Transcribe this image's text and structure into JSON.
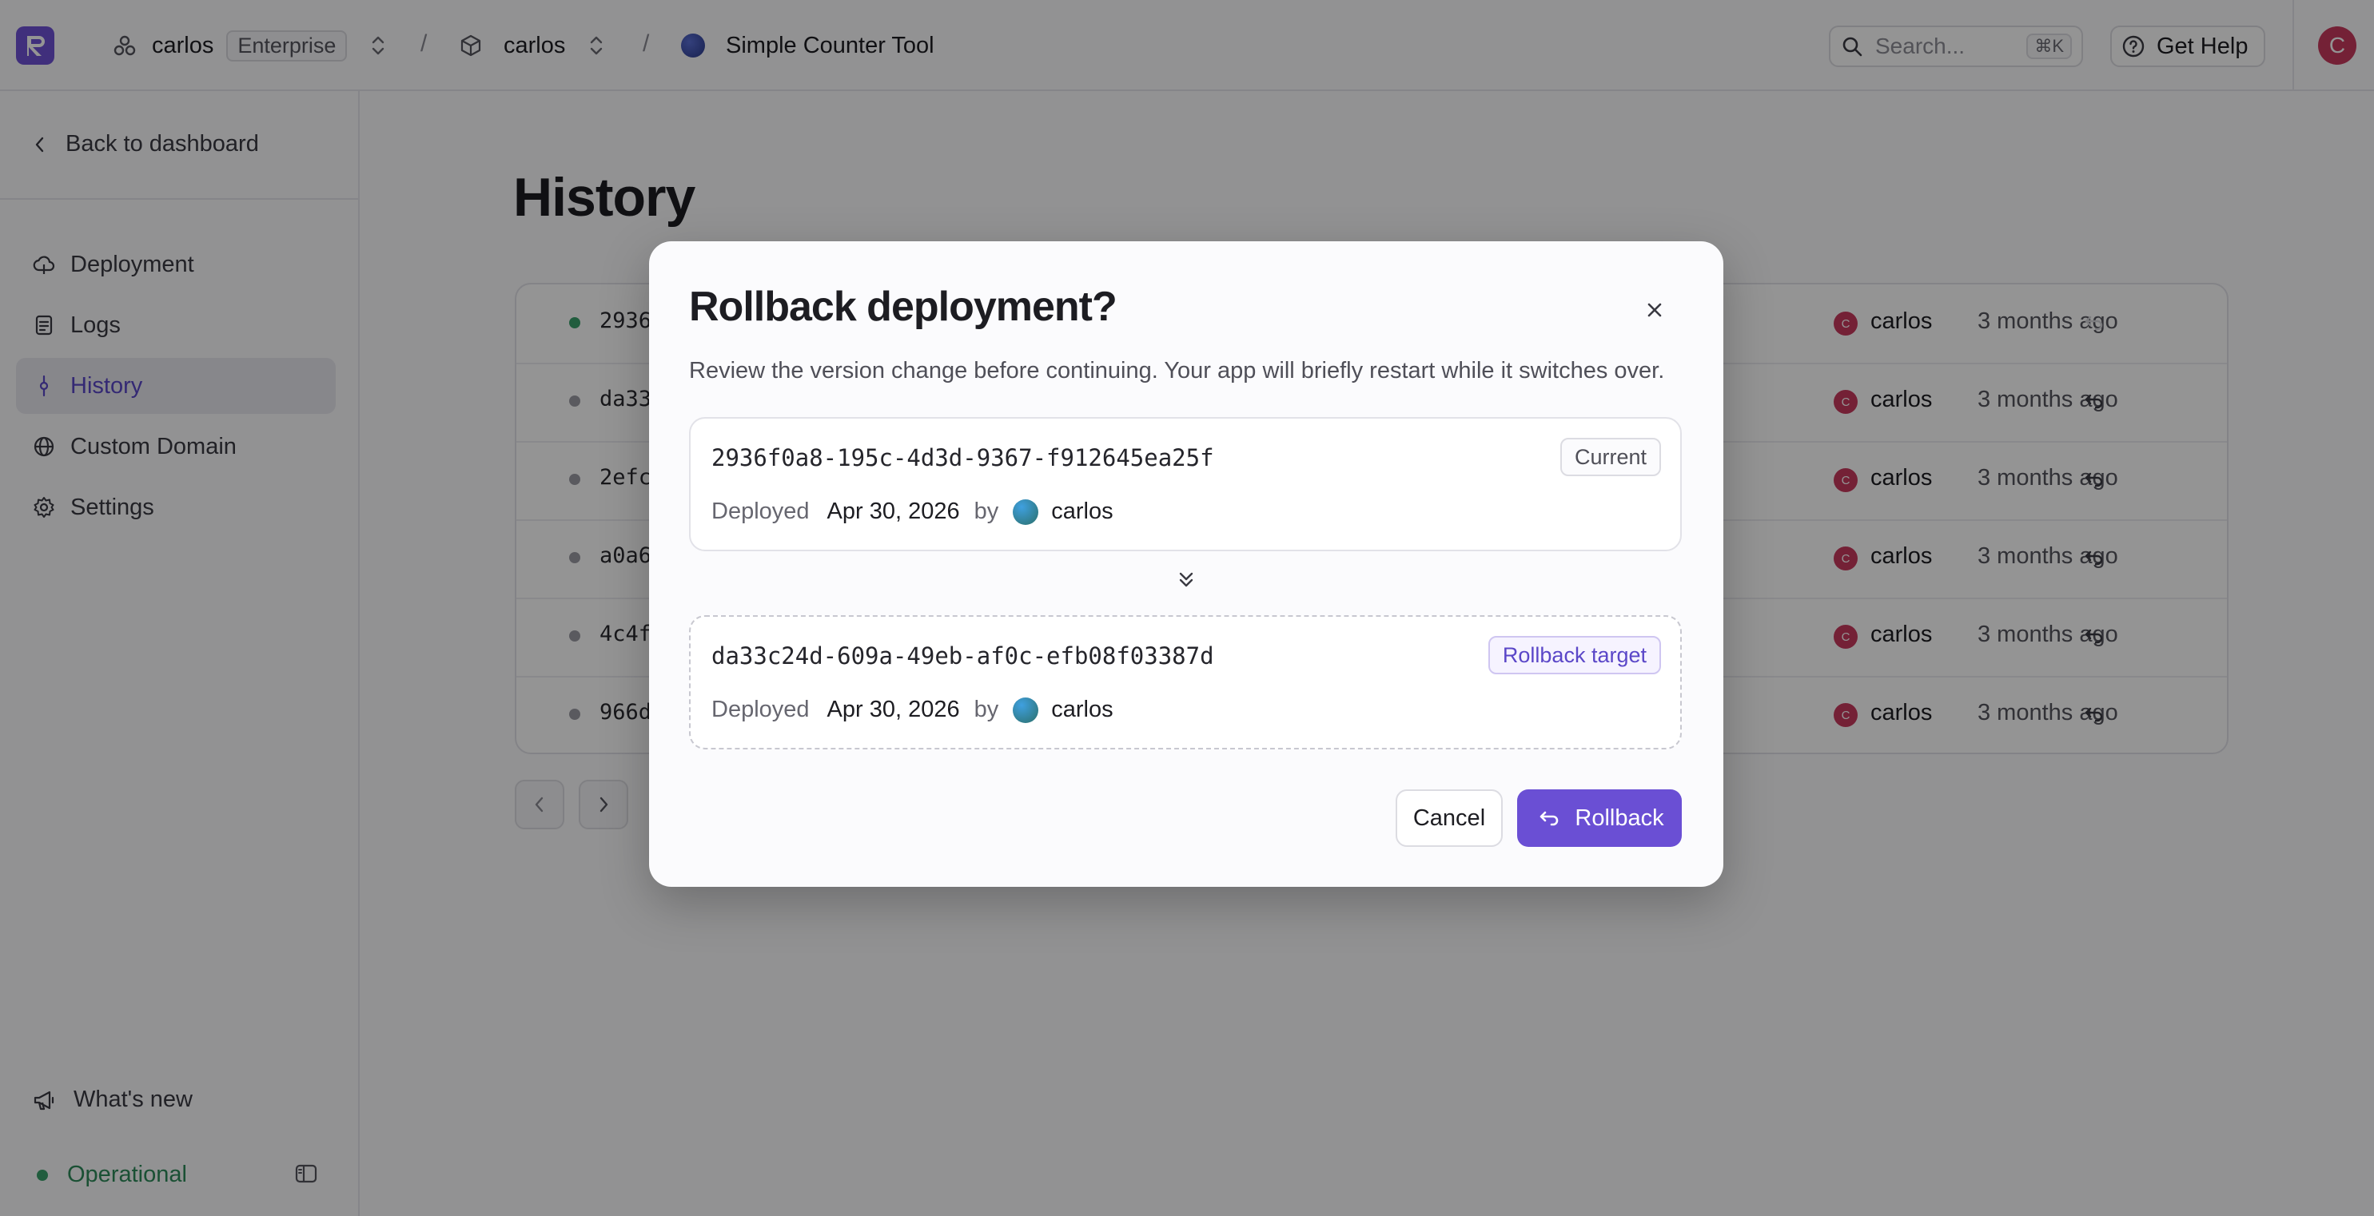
{
  "colors": {
    "accent": "#6a4fd4",
    "success": "#3aa06b",
    "avatar": "#c93a5e"
  },
  "topbar": {
    "logo_letter": "R",
    "org_name": "carlos",
    "org_plan": "Enterprise",
    "project_name": "carlos",
    "app_name": "Simple Counter Tool",
    "separator": "/",
    "search_placeholder": "Search...",
    "search_shortcut": "⌘K",
    "help_label": "Get Help",
    "user_initial": "C"
  },
  "sidebar": {
    "back_label": "Back to dashboard",
    "items": [
      {
        "label": "Deployment",
        "icon": "cloud-icon"
      },
      {
        "label": "Logs",
        "icon": "file-icon"
      },
      {
        "label": "History",
        "icon": "commit-icon",
        "active": true
      },
      {
        "label": "Custom Domain",
        "icon": "globe-icon"
      },
      {
        "label": "Settings",
        "icon": "gear-icon"
      }
    ],
    "whats_new": "What's new",
    "status": "Operational"
  },
  "main": {
    "title": "History",
    "rows": [
      {
        "id": "2936",
        "live": true,
        "user": "carlos",
        "user_initial": "C",
        "time": "3 months ago"
      },
      {
        "id": "da33",
        "live": false,
        "user": "carlos",
        "user_initial": "C",
        "time": "3 months ago"
      },
      {
        "id": "2efc",
        "live": false,
        "user": "carlos",
        "user_initial": "C",
        "time": "3 months ago"
      },
      {
        "id": "a0a6",
        "live": false,
        "user": "carlos",
        "user_initial": "C",
        "time": "3 months ago"
      },
      {
        "id": "4c4f",
        "live": false,
        "user": "carlos",
        "user_initial": "C",
        "time": "3 months ago"
      },
      {
        "id": "966d",
        "live": false,
        "user": "carlos",
        "user_initial": "C",
        "time": "3 months ago"
      }
    ]
  },
  "modal": {
    "title": "Rollback deployment?",
    "description": "Review the version change before continuing. Your app will briefly restart while it switches over.",
    "current": {
      "id": "2936f0a8-195c-4d3d-9367-f912645ea25f",
      "tag": "Current",
      "deployed_label": "Deployed",
      "date": "Apr 30, 2026",
      "by": "by",
      "user": "carlos"
    },
    "target": {
      "id": "da33c24d-609a-49eb-af0c-efb08f03387d",
      "tag": "Rollback target",
      "deployed_label": "Deployed",
      "date": "Apr 30, 2026",
      "by": "by",
      "user": "carlos"
    },
    "cancel_label": "Cancel",
    "rollback_label": "Rollback"
  }
}
